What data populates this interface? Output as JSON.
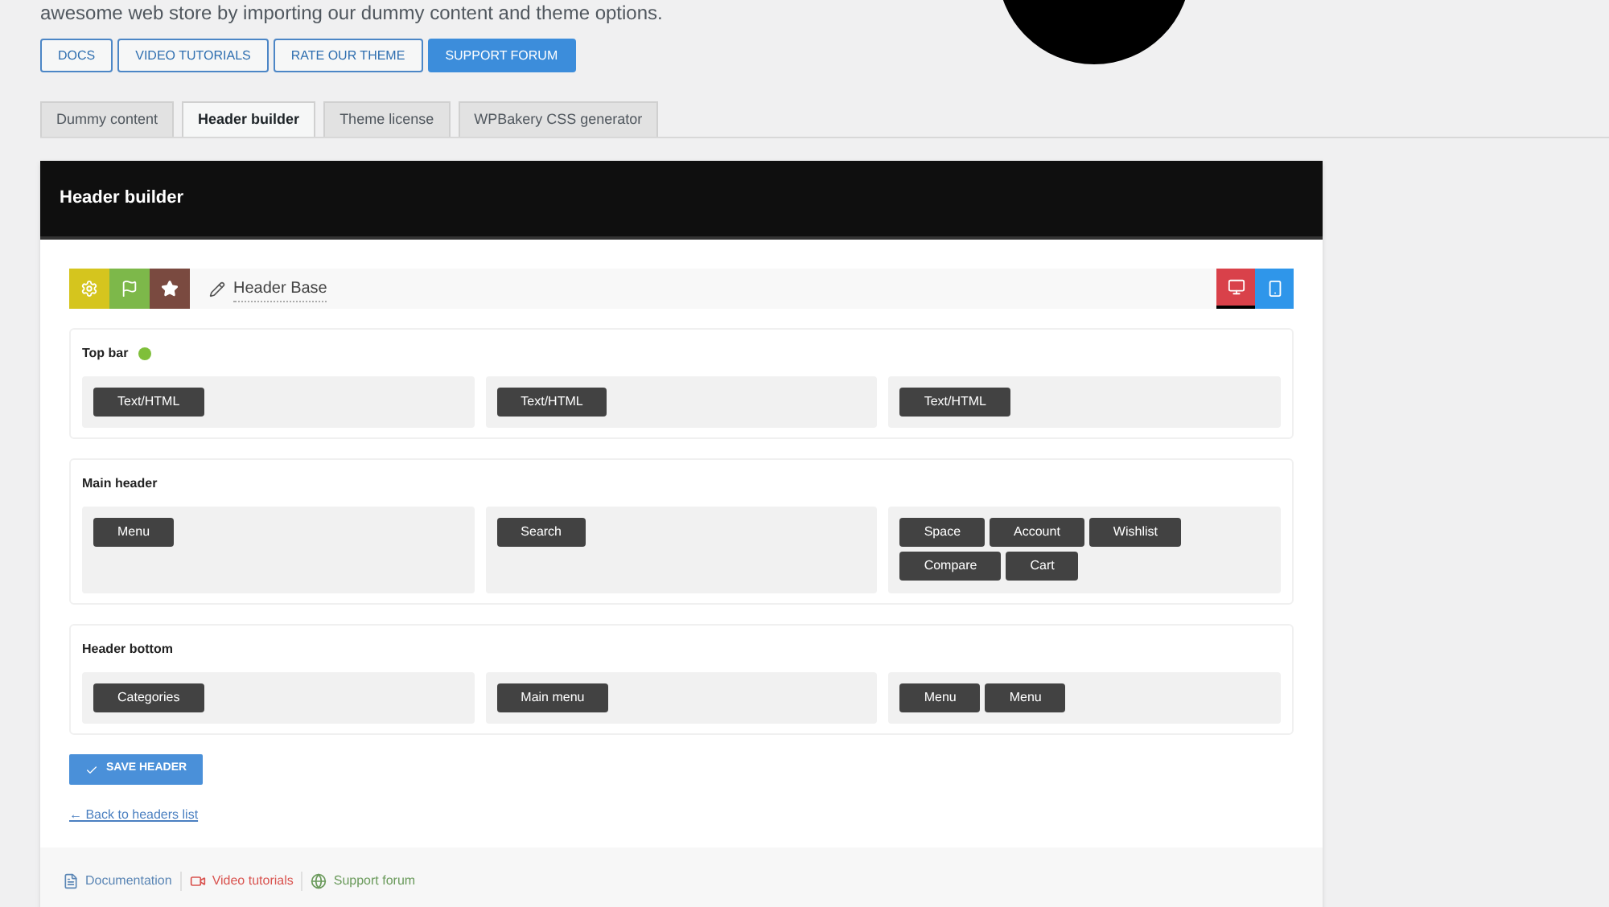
{
  "intro": "awesome web store by importing our dummy content and theme options.",
  "links": [
    {
      "label": "DOCS",
      "primary": false
    },
    {
      "label": "VIDEO TUTORIALS",
      "primary": false
    },
    {
      "label": "RATE OUR THEME",
      "primary": false
    },
    {
      "label": "SUPPORT FORUM",
      "primary": true
    }
  ],
  "tabs": [
    {
      "label": "Dummy content",
      "selected": false
    },
    {
      "label": "Header builder",
      "selected": true
    },
    {
      "label": "Theme license",
      "selected": false
    },
    {
      "label": "WPBakery CSS generator",
      "selected": false
    }
  ],
  "panel": {
    "title": "Header builder",
    "header_name": "Header Base",
    "view_modes": [
      {
        "kind": "desktop",
        "selected": true
      },
      {
        "kind": "mobile",
        "selected": false
      }
    ],
    "rows": [
      {
        "title": "Top bar",
        "enabled": true,
        "columns": [
          [
            "Text/HTML"
          ],
          [
            "Text/HTML"
          ],
          [
            "Text/HTML"
          ]
        ]
      },
      {
        "title": "Main header",
        "columns": [
          [
            "Menu"
          ],
          [
            "Search"
          ],
          [
            "Space",
            "Account",
            "Wishlist",
            "Compare",
            "Cart"
          ]
        ]
      },
      {
        "title": "Header bottom",
        "columns": [
          [
            "Categories"
          ],
          [
            "Main menu"
          ],
          [
            "Menu",
            "Menu"
          ]
        ]
      }
    ],
    "save": "SAVE HEADER",
    "back": "← Back to headers list"
  },
  "footer_links": [
    {
      "kind": "doc",
      "label": "Documentation"
    },
    {
      "kind": "video",
      "label": "Video tutorials"
    },
    {
      "kind": "forum",
      "label": "Support forum"
    }
  ]
}
